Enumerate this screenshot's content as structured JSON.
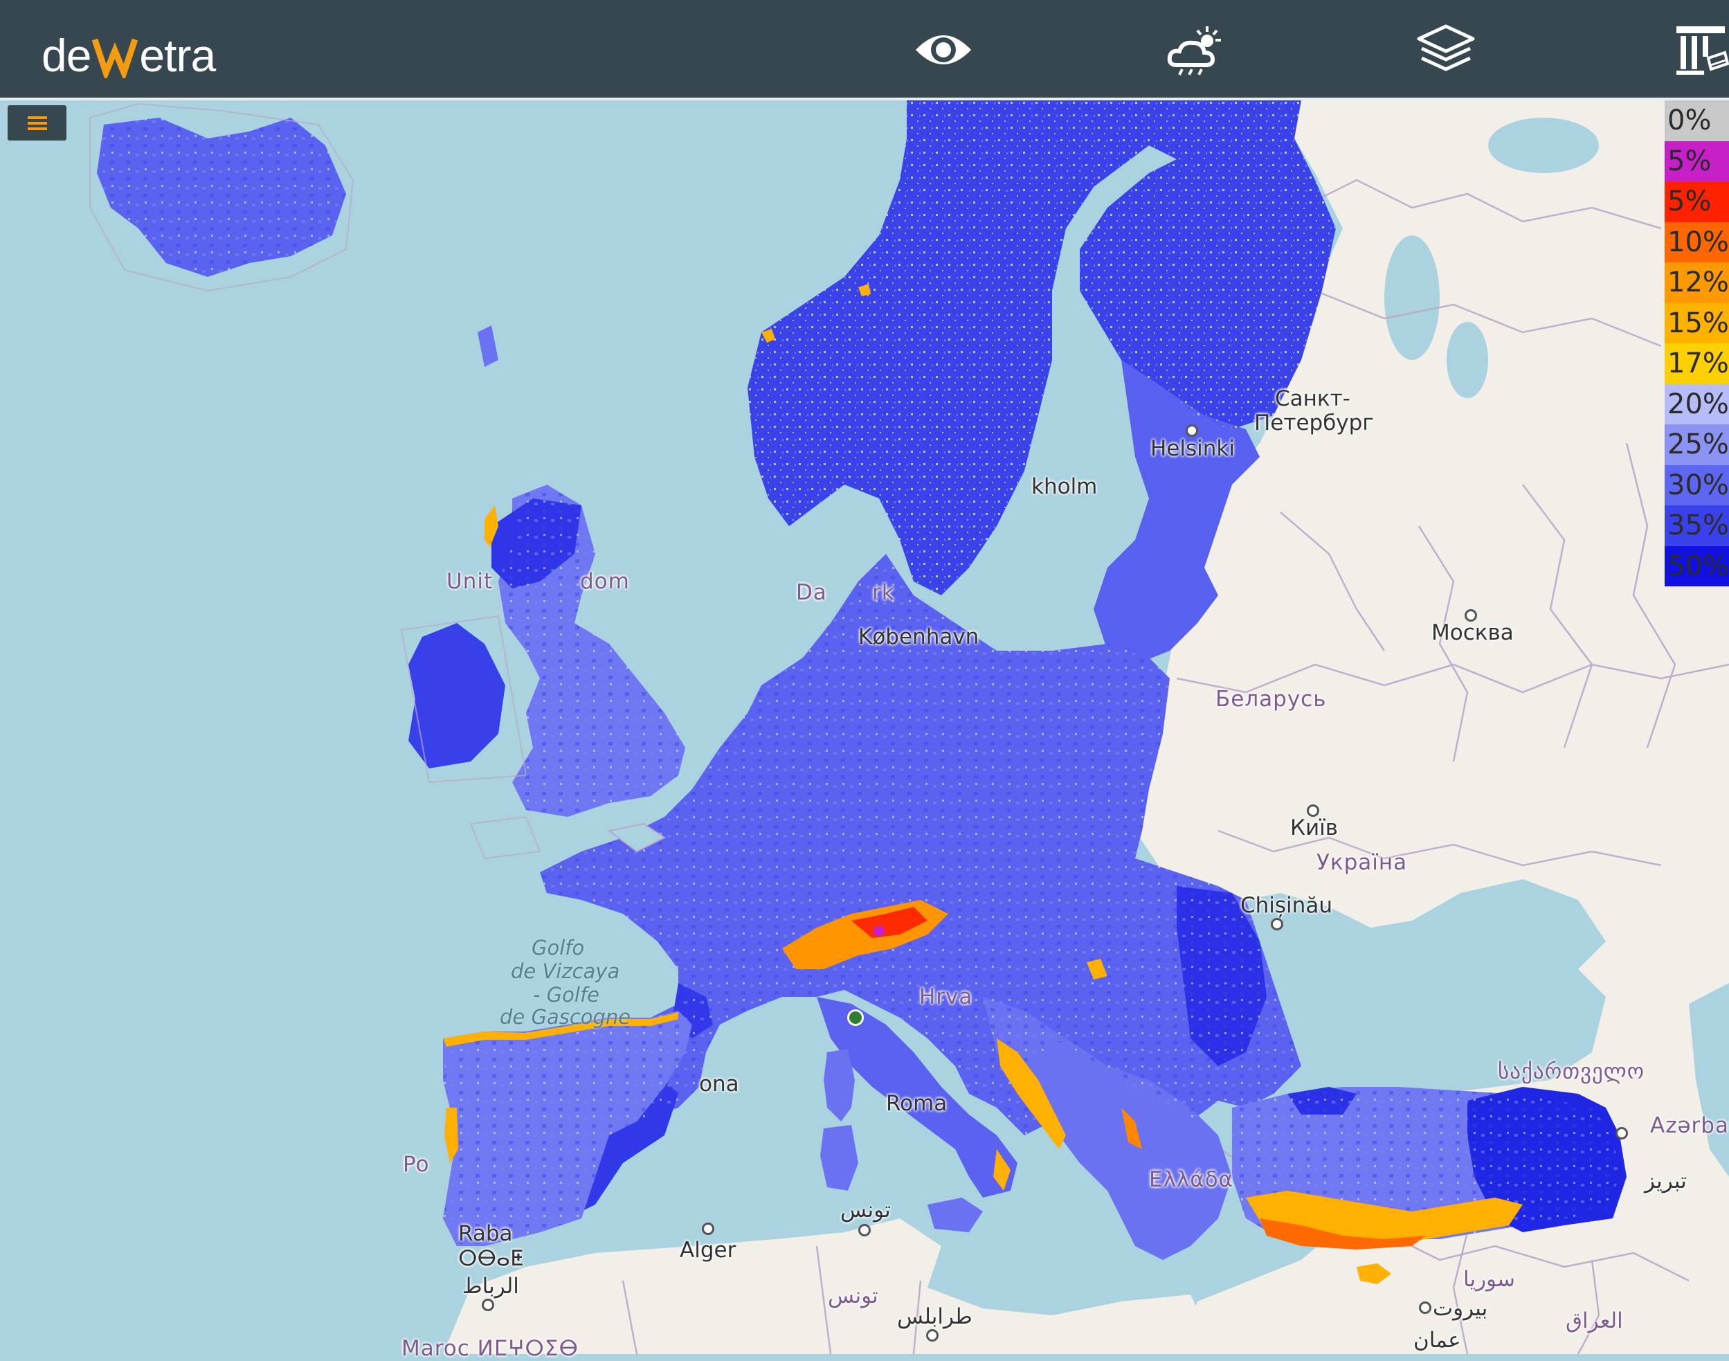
{
  "app": {
    "logo_text": "dewetra",
    "brand_color": "#f39c12",
    "topbar_color": "#37474f"
  },
  "toolbar": {
    "buttons": [
      {
        "name": "observation",
        "icon": "eye-icon"
      },
      {
        "name": "forecast",
        "icon": "cloud-sun-icon"
      },
      {
        "name": "layers",
        "icon": "layers-icon"
      },
      {
        "name": "institutions",
        "icon": "building-icon"
      }
    ]
  },
  "menu": {
    "icon": "hamburger-icon"
  },
  "legend": {
    "items": [
      {
        "label": "0%",
        "color": "#c8c8c8"
      },
      {
        "label": "5%",
        "color": "#c71fc7"
      },
      {
        "label": "5%",
        "color": "#ff2200"
      },
      {
        "label": "10%",
        "color": "#ff6600"
      },
      {
        "label": "12%",
        "color": "#ff9900"
      },
      {
        "label": "15%",
        "color": "#ffb300"
      },
      {
        "label": "17%",
        "color": "#ffd000"
      },
      {
        "label": "20%",
        "color": "#b5bcf8"
      },
      {
        "label": "25%",
        "color": "#8b93f4"
      },
      {
        "label": "30%",
        "color": "#5d66f0"
      },
      {
        "label": "35%",
        "color": "#3841ea"
      },
      {
        "label": "50%",
        "color": "#1010e0"
      }
    ]
  },
  "map_labels": {
    "places": [
      {
        "text": "Санкт-",
        "kind": "city"
      },
      {
        "text": "Петербург",
        "kind": "city"
      },
      {
        "text": "Helsinki",
        "kind": "city"
      },
      {
        "text": "kholm",
        "kind": "city"
      },
      {
        "text": "Unit",
        "kind": "country"
      },
      {
        "text": "dom",
        "kind": "country"
      },
      {
        "text": "Da",
        "kind": "country"
      },
      {
        "text": "rk",
        "kind": "country"
      },
      {
        "text": "København",
        "kind": "city"
      },
      {
        "text": "Москва",
        "kind": "city"
      },
      {
        "text": "Беларусь",
        "kind": "country"
      },
      {
        "text": "Київ",
        "kind": "city"
      },
      {
        "text": "Україна",
        "kind": "country"
      },
      {
        "text": "Chișinău",
        "kind": "city"
      },
      {
        "text": "Golfo",
        "kind": "sea"
      },
      {
        "text": "de Vizcaya",
        "kind": "sea"
      },
      {
        "text": "- Golfe",
        "kind": "sea"
      },
      {
        "text": "de Gascogne",
        "kind": "sea"
      },
      {
        "text": "Hrva",
        "kind": "country"
      },
      {
        "text": "ona",
        "kind": "city"
      },
      {
        "text": "Roma",
        "kind": "city"
      },
      {
        "text": "Po",
        "kind": "country"
      },
      {
        "text": "Raba",
        "kind": "city"
      },
      {
        "text": "ⵔⴱⴰⵟ",
        "kind": "city"
      },
      {
        "text": "الرباط",
        "kind": "city"
      },
      {
        "text": "Alger",
        "kind": "city"
      },
      {
        "text": "تونس",
        "kind": "city"
      },
      {
        "text": "تونس",
        "kind": "country"
      },
      {
        "text": "طرابلس",
        "kind": "city"
      },
      {
        "text": "საქართველო",
        "kind": "country"
      },
      {
        "text": "Azərbay",
        "kind": "country"
      },
      {
        "text": "تبریز",
        "kind": "city"
      },
      {
        "text": "سوريا",
        "kind": "country"
      },
      {
        "text": "بيروت",
        "kind": "city"
      },
      {
        "text": "العراق",
        "kind": "country"
      },
      {
        "text": "عمان",
        "kind": "city"
      },
      {
        "text": "Maroc ⵍⵎⵖⵔⵉⴱ",
        "kind": "country"
      },
      {
        "text": "Ελλάδα",
        "kind": "country"
      }
    ]
  },
  "colors": {
    "sea": "#aad3df",
    "land": "#f2efe9",
    "border": "#b9a8c9"
  }
}
